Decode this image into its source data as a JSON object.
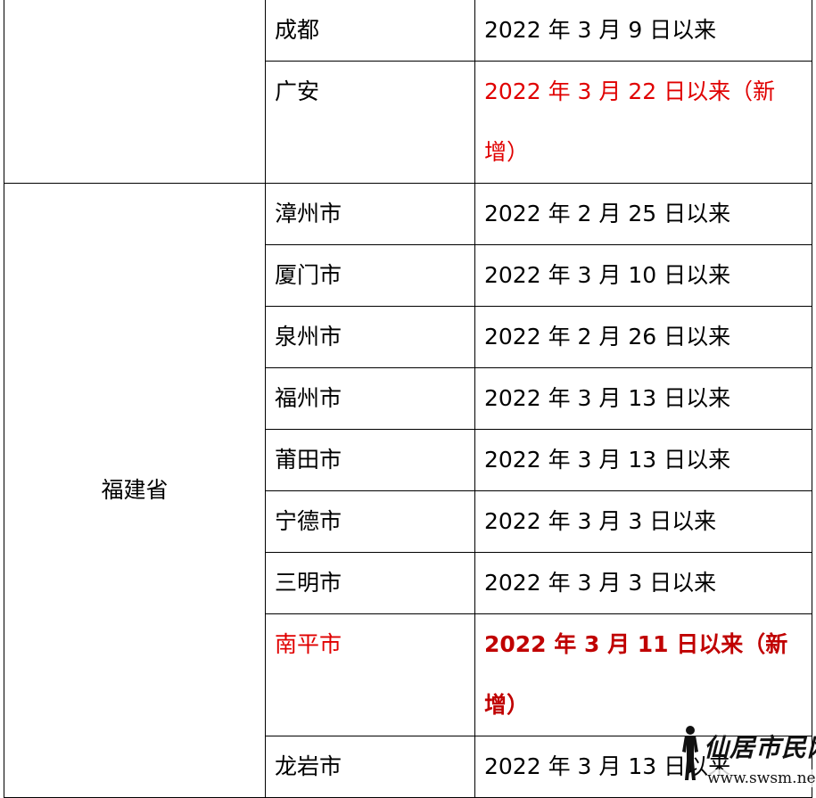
{
  "table": {
    "rows": [
      {
        "city": "成都",
        "date": "2022 年 3 月 9 日以来"
      },
      {
        "city": "广安",
        "date": "2022 年 3 月 22 日以来（新增）"
      }
    ],
    "province_group": {
      "province": "福建省",
      "rows": [
        {
          "city": "漳州市",
          "date": "2022 年 2 月 25 日以来"
        },
        {
          "city": "厦门市",
          "date": "2022 年 3 月 10 日以来"
        },
        {
          "city": "泉州市",
          "date": "2022 年 2 月 26 日以来"
        },
        {
          "city": "福州市",
          "date": "2022 年 3 月 13 日以来"
        },
        {
          "city": "莆田市",
          "date": "2022 年 3 月 13 日以来"
        },
        {
          "city": "宁德市",
          "date": "2022 年 3 月 3 日以来"
        },
        {
          "city": "三明市",
          "date": "2022 年 3 月 3 日以来"
        },
        {
          "city": "南平市",
          "date": "2022 年 3 月 11 日以来（新增）"
        },
        {
          "city": "龙岩市",
          "date": "2022 年 3 月 13 日以来"
        }
      ]
    }
  },
  "colors": {
    "new_text": "#e00000",
    "new_bold_text": "#c00000",
    "border": "#000000"
  },
  "watermark": {
    "logo_text": "仙居市民网",
    "url": "www.swsm.net",
    "icon": "standing-man-silhouette-icon"
  }
}
